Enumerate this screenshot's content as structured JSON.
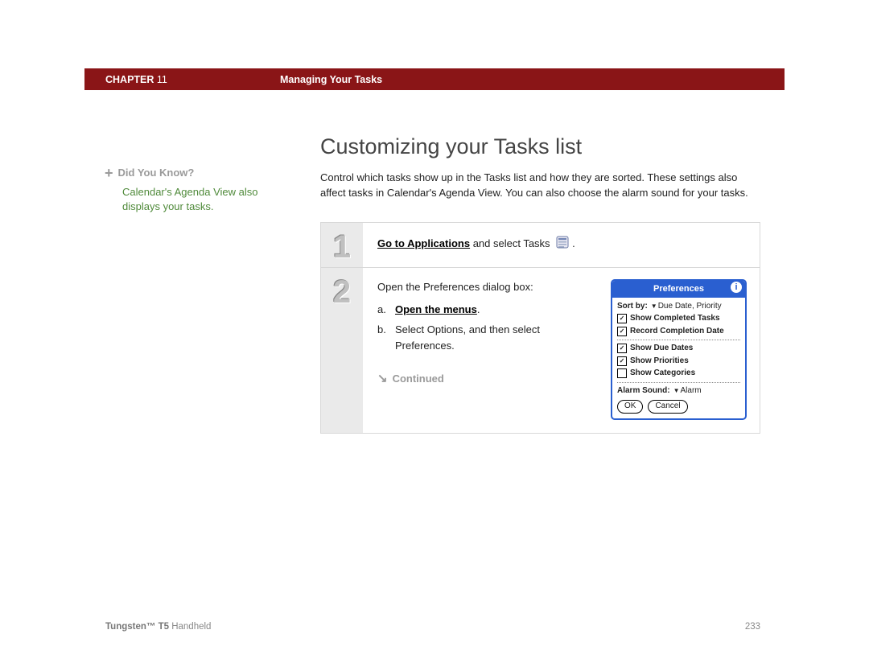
{
  "header": {
    "chapter_label": "CHAPTER",
    "chapter_number": "11",
    "chapter_title": "Managing Your Tasks"
  },
  "sidebar": {
    "dyk_label": "Did You Know?",
    "dyk_link": "Calendar's Agenda View",
    "dyk_rest": "also displays your tasks."
  },
  "main": {
    "title": "Customizing your Tasks list",
    "intro": "Control which tasks show up in the Tasks list and how they are sorted. These settings also affect tasks in Calendar's Agenda View. You can also choose the alarm sound for your tasks.",
    "step1": {
      "num": "1",
      "link": "Go to Applications",
      "rest": " and select Tasks ",
      "tail": "."
    },
    "step2": {
      "num": "2",
      "lead": "Open the Preferences dialog box:",
      "a_marker": "a.",
      "a_text": "Open the menus",
      "a_tail": ".",
      "b_marker": "b.",
      "b_text": "Select Options, and then select Preferences.",
      "continued": "Continued"
    }
  },
  "prefs": {
    "title": "Preferences",
    "sort_label": "Sort by:",
    "sort_value": "Due Date, Priority",
    "opts": {
      "completed": "Show Completed Tasks",
      "record": "Record Completion Date",
      "due": "Show Due Dates",
      "pri": "Show Priorities",
      "cat": "Show Categories"
    },
    "alarm_label": "Alarm Sound:",
    "alarm_value": "Alarm",
    "ok": "OK",
    "cancel": "Cancel"
  },
  "footer": {
    "product_bold": "Tungsten™ T5",
    "product_rest": " Handheld",
    "page": "233"
  }
}
